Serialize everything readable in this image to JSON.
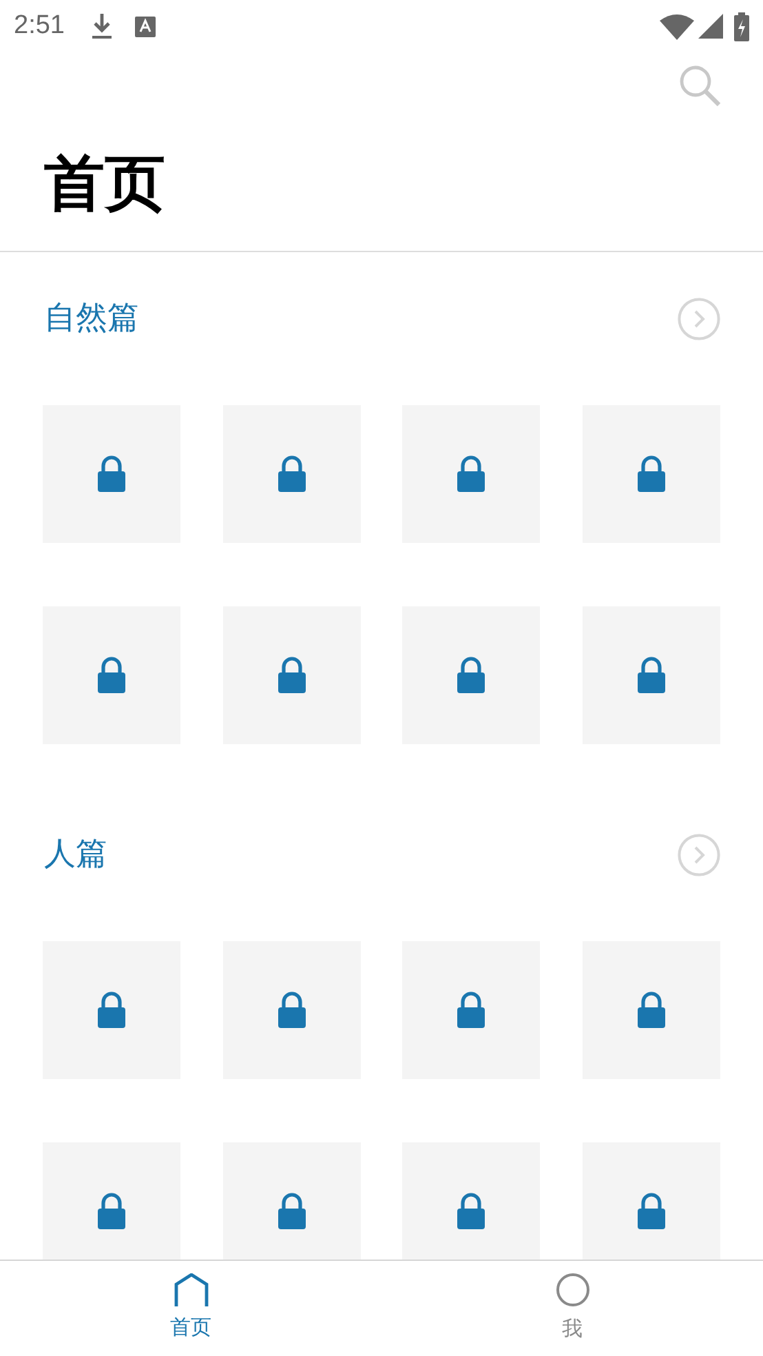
{
  "status_bar": {
    "time": "2:51"
  },
  "page_title": "首页",
  "sections": [
    {
      "title": "自然篇",
      "tiles": [
        {
          "locked": true
        },
        {
          "locked": true
        },
        {
          "locked": true
        },
        {
          "locked": true
        },
        {
          "locked": true
        },
        {
          "locked": true
        },
        {
          "locked": true
        },
        {
          "locked": true
        }
      ]
    },
    {
      "title": "人篇",
      "tiles": [
        {
          "locked": true
        },
        {
          "locked": true
        },
        {
          "locked": true
        },
        {
          "locked": true
        },
        {
          "locked": true
        },
        {
          "locked": true
        },
        {
          "locked": true
        },
        {
          "locked": true
        }
      ]
    }
  ],
  "bottom_nav": [
    {
      "label": "首页",
      "kind": "home",
      "selected": true
    },
    {
      "label": "我",
      "kind": "profile",
      "selected": false
    }
  ]
}
